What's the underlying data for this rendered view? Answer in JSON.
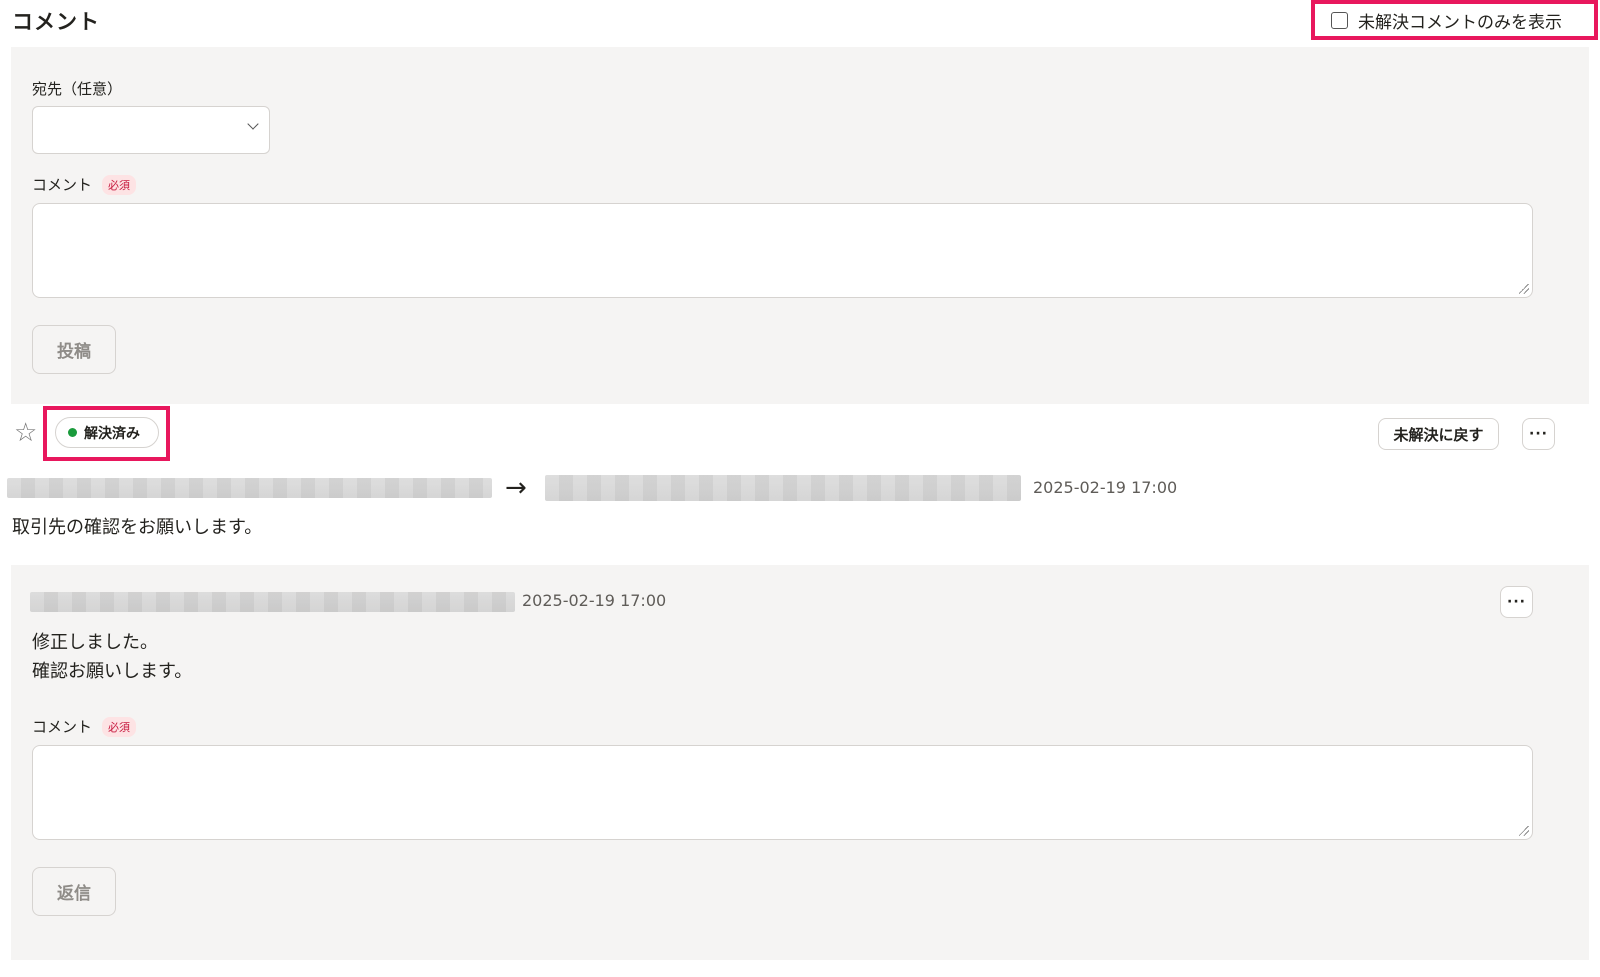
{
  "header": {
    "title": "コメント",
    "filter_label": "未解決コメントのみを表示",
    "filter_checked": false
  },
  "compose": {
    "recipient_label": "宛先（任意）",
    "recipient_value": "",
    "comment_label": "コメント",
    "required_badge": "必須",
    "comment_value": "",
    "submit_label": "投稿"
  },
  "thread": {
    "star_icon": "star-outline-icon",
    "status_label": "解決済み",
    "status_color": "#1a9b3c",
    "unresolve_label": "未解決に戻す",
    "more_label": "···",
    "arrow": "→",
    "timestamp": "2025-02-19 17:00",
    "body": "取引先の確認をお願いします。"
  },
  "reply": {
    "timestamp": "2025-02-19 17:00",
    "more_label": "···",
    "body_lines": [
      "修正しました。",
      "確認お願いします。"
    ],
    "comment_label": "コメント",
    "required_badge": "必須",
    "comment_value": "",
    "submit_label": "返信"
  },
  "colors": {
    "highlight": "#e8175d",
    "panel_bg": "#f5f4f3",
    "required_bg": "#fde3e4",
    "required_text": "#c71a3f"
  }
}
